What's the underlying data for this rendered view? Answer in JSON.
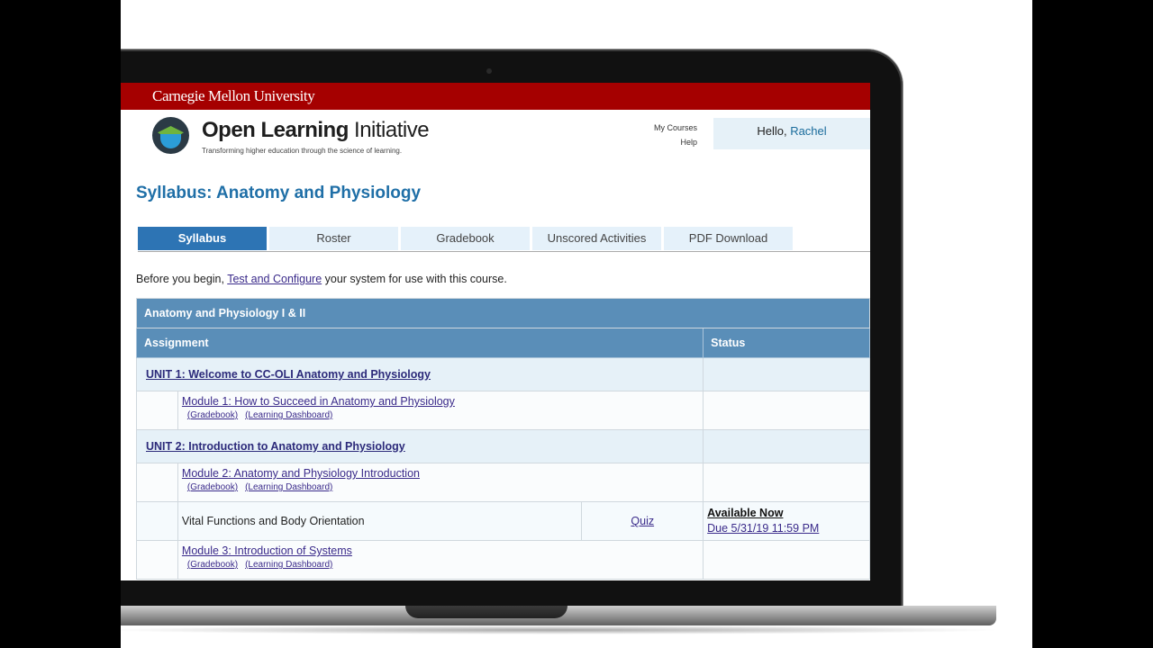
{
  "university": "Carnegie Mellon University",
  "logo": {
    "title_bold": "Open Learning",
    "title_light": " Initiative",
    "tagline": "Transforming higher education through the science of learning."
  },
  "header": {
    "links": [
      "My Courses",
      "Help"
    ],
    "greeting": "Hello, ",
    "user": "Rachel"
  },
  "page_title": "Syllabus: Anatomy and Physiology",
  "tabs": [
    {
      "label": "Syllabus",
      "active": true
    },
    {
      "label": "Roster"
    },
    {
      "label": "Gradebook"
    },
    {
      "label": "Unscored Activities"
    },
    {
      "label": "PDF Download"
    }
  ],
  "intro": {
    "before": "Before you begin, ",
    "link": "Test and Configure",
    "after": " your system for use with this course."
  },
  "table": {
    "course": "Anatomy and Physiology I & II",
    "col_assignment": "Assignment",
    "col_status": "Status",
    "unit1": "UNIT 1: Welcome to CC-OLI Anatomy and Physiology",
    "module1": "Module 1: How to Succeed in Anatomy and Physiology",
    "gradebook_link": "(Gradebook)",
    "dashboard_link": "(Learning Dashboard)",
    "unit2": "UNIT 2: Introduction to Anatomy and Physiology",
    "module2": "Module 2: Anatomy and Physiology Introduction",
    "activity": {
      "name": "Vital Functions and Body Orientation",
      "type": "Quiz",
      "availability": "Available Now",
      "due": "Due 5/31/19 11:59 PM"
    },
    "module3": "Module 3: Introduction of Systems"
  },
  "colors": {
    "cmu_red": "#a50000",
    "tab_active": "#2d74b4",
    "table_header": "#5a8eb8",
    "title_blue": "#1f6fa7"
  }
}
